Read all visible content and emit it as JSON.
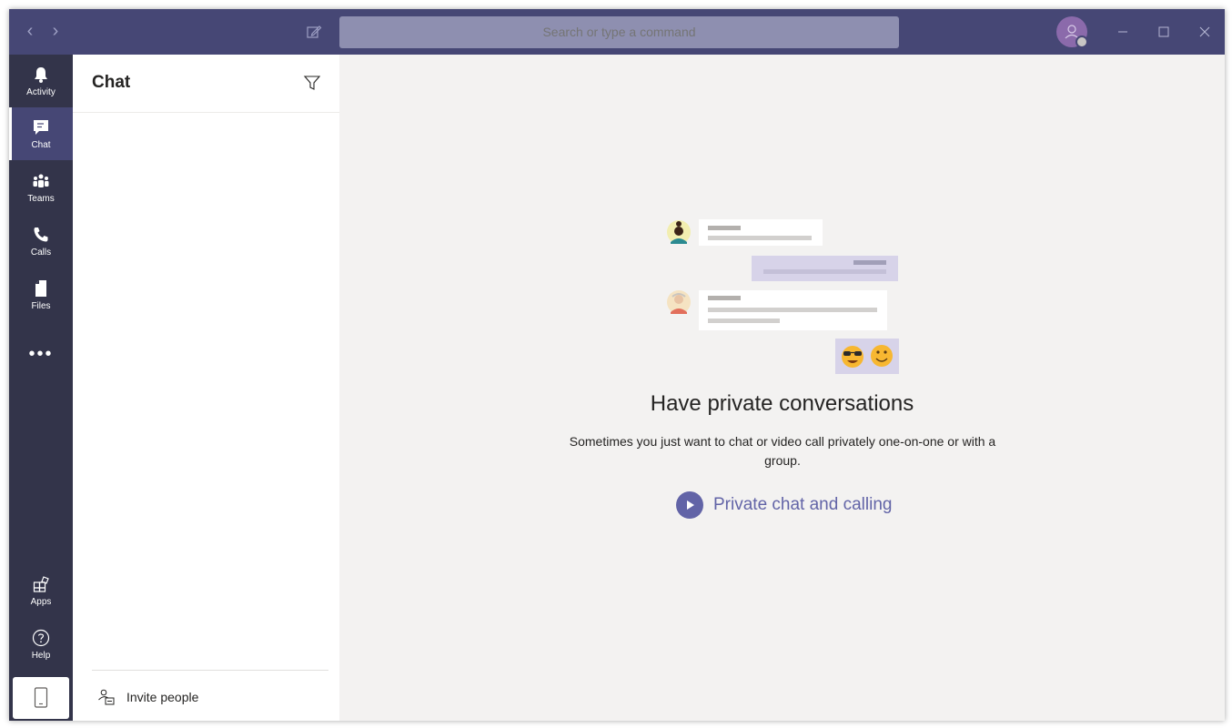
{
  "titlebar": {
    "search_placeholder": "Search or type a command",
    "back_icon": "chevron-left-icon",
    "forward_icon": "chevron-right-icon",
    "compose_icon": "compose-icon"
  },
  "rail": {
    "items": [
      {
        "label": "Activity",
        "icon": "bell-icon"
      },
      {
        "label": "Chat",
        "icon": "chat-icon",
        "active": true
      },
      {
        "label": "Teams",
        "icon": "teams-icon"
      },
      {
        "label": "Calls",
        "icon": "phone-icon"
      },
      {
        "label": "Files",
        "icon": "file-icon"
      }
    ],
    "more": "•••",
    "bottom_items": [
      {
        "label": "Apps",
        "icon": "apps-icon"
      },
      {
        "label": "Help",
        "icon": "help-icon"
      }
    ],
    "device_icon": "mobile-icon"
  },
  "chat_panel": {
    "title": "Chat",
    "filter_icon": "filter-icon",
    "invite_label": "Invite people"
  },
  "main": {
    "heading": "Have private conversations",
    "subtext": "Sometimes you just want to chat or video call privately one-on-one or with a group.",
    "video_link": "Private chat and calling"
  },
  "colors": {
    "titlebar": "#464775",
    "rail": "#33344a",
    "accent": "#6264a7",
    "main_bg": "#f3f2f1"
  }
}
